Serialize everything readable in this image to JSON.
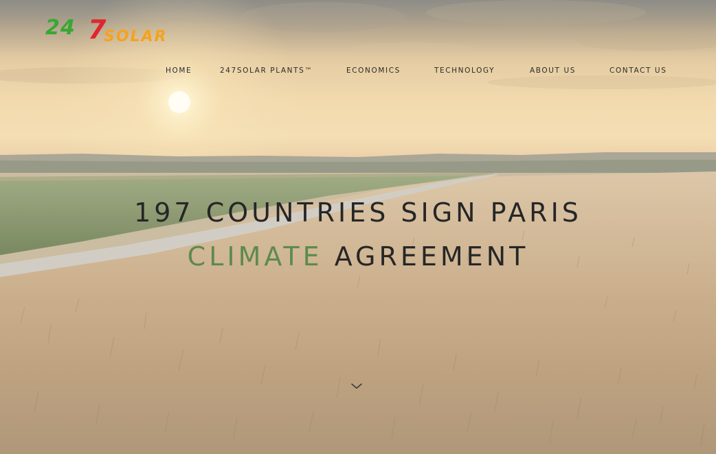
{
  "logo": {
    "digits": "247",
    "word": "SOLAR",
    "green": "#38a832",
    "red": "#e0262d",
    "orange": "#f6a21c"
  },
  "nav": {
    "items": [
      {
        "label": "HOME"
      },
      {
        "label": "247SOLAR PLANTS™"
      },
      {
        "label": "ECONOMICS"
      },
      {
        "label": "TECHNOLOGY"
      },
      {
        "label": "ABOUT US"
      },
      {
        "label": "CONTACT US"
      }
    ]
  },
  "hero": {
    "line1": "197 COUNTRIES SIGN PARIS",
    "line2_accent": "CLIMATE",
    "line2_rest": " AGREEMENT",
    "accent_color": "#5d8a4e",
    "scroll_icon": "chevron-down-icon"
  }
}
